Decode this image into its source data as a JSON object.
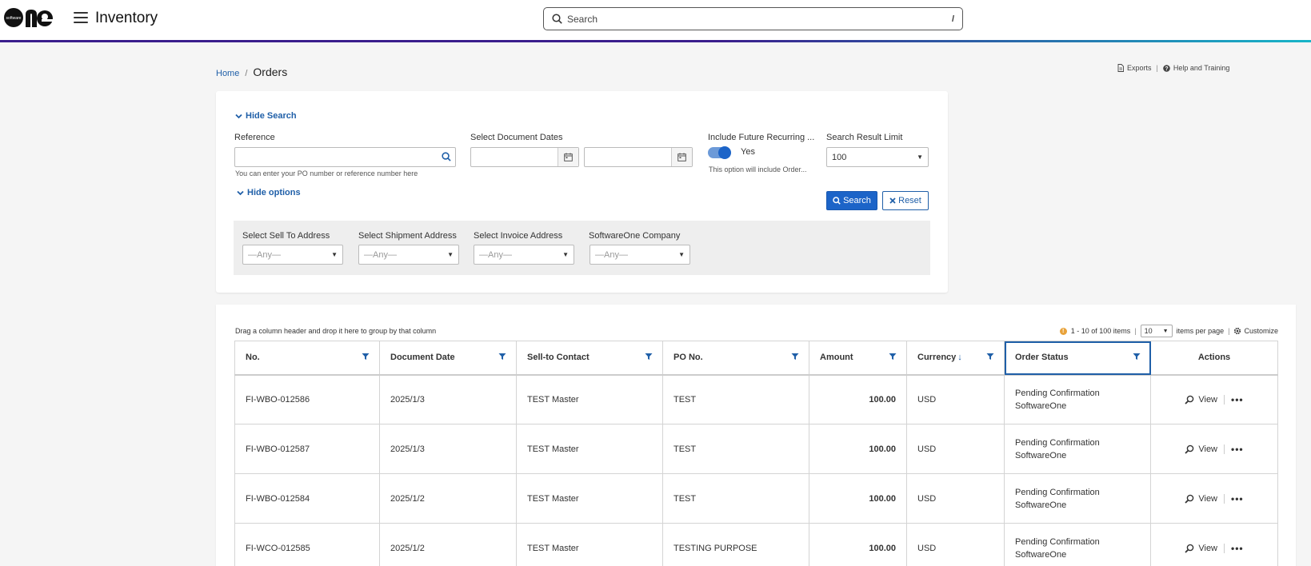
{
  "header": {
    "logo_text": "software one",
    "app_title": "Inventory",
    "search_placeholder": "Search",
    "search_shortcut": "/"
  },
  "breadcrumb": {
    "home": "Home",
    "separator": "/",
    "current": "Orders"
  },
  "top_links": {
    "exports": "Exports",
    "divider": "|",
    "help": "Help and Training"
  },
  "search_panel": {
    "hide_search": "Hide Search",
    "reference": {
      "label": "Reference",
      "value": "",
      "hint": "You can enter your PO number or reference number here"
    },
    "document_dates": {
      "label": "Select Document Dates",
      "from": "",
      "to": ""
    },
    "future_recurring": {
      "label": "Include Future Recurring ...",
      "state": "Yes",
      "hint": "This option will include Order..."
    },
    "result_limit": {
      "label": "Search Result Limit",
      "value": "100"
    },
    "hide_options": "Hide options",
    "search_button": "Search",
    "reset_button": "Reset",
    "options": [
      {
        "label": "Select Sell To Address",
        "value": "—Any—"
      },
      {
        "label": "Select Shipment Address",
        "value": "—Any—"
      },
      {
        "label": "Select Invoice Address",
        "value": "—Any—"
      },
      {
        "label": "SoftwareOne Company",
        "value": "—Any—"
      }
    ]
  },
  "grid": {
    "group_hint": "Drag a column header and drop it here to group by that column",
    "pager": {
      "range": "1 - 10 of 100 items",
      "sep": "|",
      "page_size": "10",
      "items_per_page": "items per page",
      "customize": "Customize"
    },
    "columns": [
      "No.",
      "Document Date",
      "Sell-to Contact",
      "PO No.",
      "Amount",
      "Currency",
      "Order Status",
      "Actions"
    ],
    "view_label": "View",
    "rows": [
      {
        "no": "FI-WBO-012586",
        "date": "2025/1/3",
        "contact": "TEST Master",
        "po": "TEST",
        "amount": "100.00",
        "currency": "USD",
        "status1": "Pending Confirmation",
        "status2": "SoftwareOne"
      },
      {
        "no": "FI-WBO-012587",
        "date": "2025/1/3",
        "contact": "TEST Master",
        "po": "TEST",
        "amount": "100.00",
        "currency": "USD",
        "status1": "Pending Confirmation",
        "status2": "SoftwareOne"
      },
      {
        "no": "FI-WBO-012584",
        "date": "2025/1/2",
        "contact": "TEST Master",
        "po": "TEST",
        "amount": "100.00",
        "currency": "USD",
        "status1": "Pending Confirmation",
        "status2": "SoftwareOne"
      },
      {
        "no": "FI-WCO-012585",
        "date": "2025/1/2",
        "contact": "TEST Master",
        "po": "TESTING PURPOSE",
        "amount": "100.00",
        "currency": "USD",
        "status1": "Pending Confirmation",
        "status2": "SoftwareOne"
      }
    ]
  },
  "colors": {
    "accent": "#1f5fa8",
    "primary_button": "#1c64c8",
    "header_gradient_start": "#3a1e8c",
    "header_gradient_end": "#18b5c8"
  }
}
